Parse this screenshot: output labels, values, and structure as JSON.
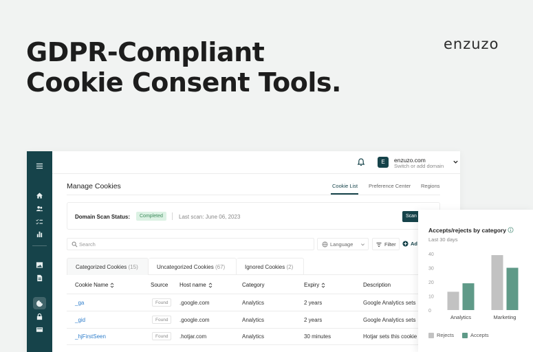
{
  "hero": {
    "line1": "GDPR-Compliant",
    "line2": "Cookie Consent Tools."
  },
  "brand": "enzuzo",
  "topbar": {
    "domain": "enzuzo.com",
    "domain_sub": "Switch or add domain",
    "avatar_letter": "E"
  },
  "page": {
    "title": "Manage Cookies",
    "tabs": [
      {
        "label": "Cookie List",
        "active": true
      },
      {
        "label": "Preference Center",
        "active": false
      },
      {
        "label": "Regions",
        "active": false
      }
    ]
  },
  "scan": {
    "label": "Domain Scan Status:",
    "status": "Completed",
    "last_scan": "Last scan: June 06, 2023",
    "button_label": "Scan"
  },
  "toolbar": {
    "search_placeholder": "Search",
    "language_label": "Language",
    "filter_label": "Filter",
    "add_label": "Ad"
  },
  "cookie_tabs": [
    {
      "label": "Categorized Cookies",
      "count": "(15)",
      "active": true
    },
    {
      "label": "Uncategorized Cookies",
      "count": "(67)",
      "active": false
    },
    {
      "label": "Ignored Cookies",
      "count": "(2)",
      "active": false
    }
  ],
  "table": {
    "headers": [
      "Cookie Name",
      "Source",
      "Host name",
      "Category",
      "Expiry",
      "Description"
    ],
    "rows": [
      {
        "name": "_ga",
        "source": "Found",
        "host": ".google.com",
        "category": "Analytics",
        "expiry": "2 years",
        "description": "Google Analytics sets"
      },
      {
        "name": "_gid",
        "source": "Found",
        "host": ".google.com",
        "category": "Analytics",
        "expiry": "2 years",
        "description": "Google Analytics sets"
      },
      {
        "name": "_hjFirstSeen",
        "source": "Found",
        "host": ".hotjar.com",
        "category": "Analytics",
        "expiry": "30 minutes",
        "description": "Hotjar sets this cookie"
      }
    ]
  },
  "chart_panel": {
    "title": "Accepts/rejects by category",
    "subtitle": "Last 30 days"
  },
  "chart_data": {
    "type": "bar",
    "title": "Accepts/rejects by category",
    "subtitle": "Last 30 days",
    "categories": [
      "Analytics",
      "Marketing"
    ],
    "series": [
      {
        "name": "Rejects",
        "values": [
          13,
          39
        ],
        "color": "#c2c2c2"
      },
      {
        "name": "Accepts",
        "values": [
          19,
          30
        ],
        "color": "#5f9a88"
      }
    ],
    "yticks": [
      0,
      10,
      20,
      30,
      40
    ],
    "ylim": [
      0,
      40
    ],
    "grid": false,
    "legend": "bottom-left"
  },
  "colors": {
    "sidebar": "#16434a",
    "accent": "#16434a",
    "link": "#2f7ecb",
    "badge_bg": "#dcf2e4",
    "badge_text": "#3d8a5b"
  }
}
